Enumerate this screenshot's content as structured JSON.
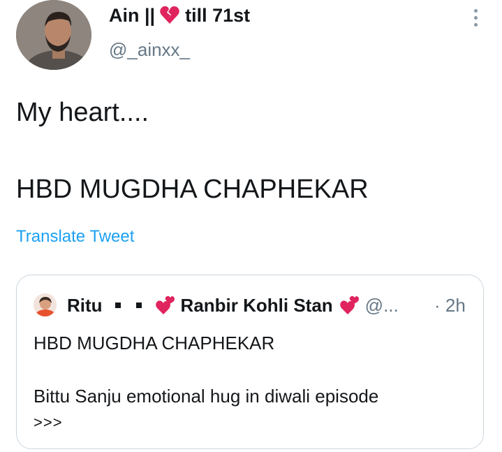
{
  "tweet": {
    "author": {
      "name_prefix": "Ain ||",
      "name_suffix": "till 71st",
      "name_emoji": "broken-heart-icon",
      "handle": "@_ainxx_"
    },
    "more_menu_icon": "more-vertical-icon",
    "lines": [
      "My heart....",
      "HBD MUGDHA CHAPHEKAR"
    ],
    "translate_label": "Translate Tweet"
  },
  "quoted_tweet": {
    "name": "Ritu",
    "separator_icons": [
      "black-square-icon",
      "black-square-icon"
    ],
    "display_name": "Ranbir Kohli Stan",
    "display_name_emoji": "two-hearts-icon",
    "handle": "@...",
    "time": "· 2h",
    "lines": [
      "HBD MUGDHA CHAPHEKAR",
      "Bittu Sanju emotional hug in diwali episode",
      ">>>"
    ]
  },
  "colors": {
    "text_primary": "#14171a",
    "text_secondary": "#657786",
    "link": "#1da1f2",
    "border": "#ccd6dd",
    "heart": "#e0245e"
  }
}
